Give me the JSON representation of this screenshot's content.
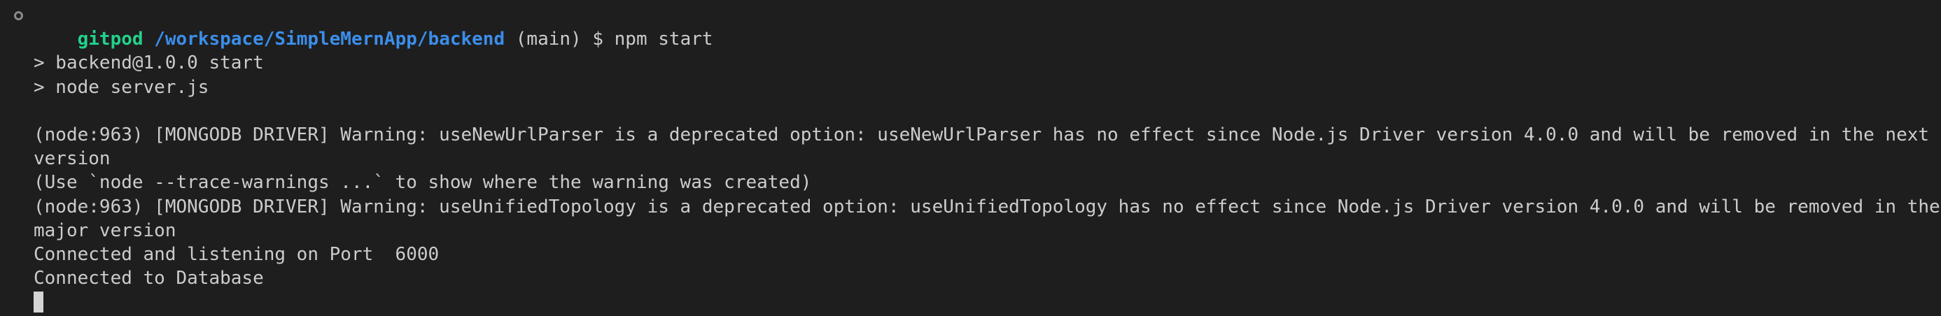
{
  "prompt": {
    "user": "gitpod",
    "path": "/workspace/SimpleMernApp/backend",
    "branch": " (main) $ ",
    "command": "npm start"
  },
  "output": {
    "script_line": "> backend@1.0.0 start",
    "node_line": "> node server.js",
    "warning1_line1": "(node:963) [MONGODB DRIVER] Warning: useNewUrlParser is a deprecated option: useNewUrlParser has no effect since Node.js Driver version 4.0.0 and will be removed in the next major",
    "warning1_line2": "version",
    "trace_hint": "(Use `node --trace-warnings ...` to show where the warning was created)",
    "warning2_line1": "(node:963) [MONGODB DRIVER] Warning: useUnifiedTopology is a deprecated option: useUnifiedTopology has no effect since Node.js Driver version 4.0.0 and will be removed in the next",
    "warning2_line2": "major version",
    "listening": "Connected and listening on Port  6000",
    "database": "Connected to Database"
  },
  "colors": {
    "background": "#1e1e1e",
    "text": "#cccccc",
    "user": "#23d18b",
    "path": "#3b8eea"
  }
}
